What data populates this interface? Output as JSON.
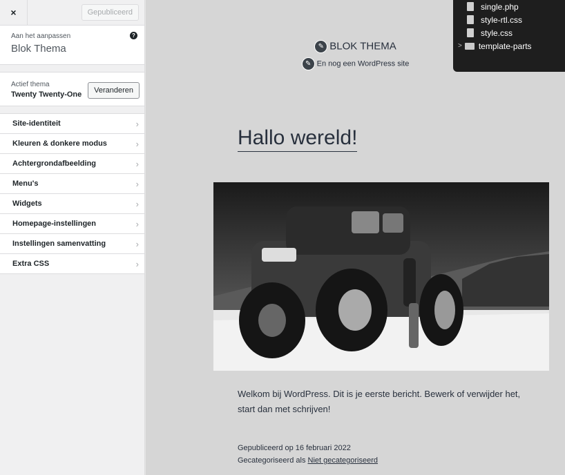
{
  "sidebar": {
    "close_symbol": "×",
    "publish_label": "Gepubliceerd",
    "customizing_label": "Aan het aanpassen",
    "customizing_title": "Blok Thema",
    "help_symbol": "?",
    "active_theme_label": "Actief thema",
    "active_theme_name": "Twenty Twenty-One",
    "change_label": "Veranderen",
    "items": [
      {
        "label": "Site-identiteit"
      },
      {
        "label": "Kleuren & donkere modus"
      },
      {
        "label": "Achtergrondafbeelding"
      },
      {
        "label": "Menu's"
      },
      {
        "label": "Widgets"
      },
      {
        "label": "Homepage-instellingen"
      },
      {
        "label": "Instellingen samenvatting"
      },
      {
        "label": "Extra CSS"
      }
    ],
    "chevron": "›"
  },
  "preview": {
    "site_title": "BLOK THEMA",
    "site_description": "En nog een WordPress site",
    "post_title": "Hallo wereld!",
    "post_text": "Welkom bij WordPress. Dit is je eerste bericht. Bewerk of verwijder het, start dan met schrijven!",
    "published": "Gepubliceerd op 16 februari 2022",
    "category_prefix": "Gecategoriseerd als ",
    "category_link": "Niet gecategoriseerd"
  },
  "finder": {
    "files": [
      {
        "name": "single.php",
        "type": "file"
      },
      {
        "name": "style-rtl.css",
        "type": "file"
      },
      {
        "name": "style.css",
        "type": "file"
      },
      {
        "name": "template-parts",
        "type": "folder"
      }
    ]
  },
  "colors": {
    "sidebar_bg": "#f0f0f1",
    "preview_bg": "#d6d6d6",
    "finder_bg": "#1e1e1e"
  }
}
